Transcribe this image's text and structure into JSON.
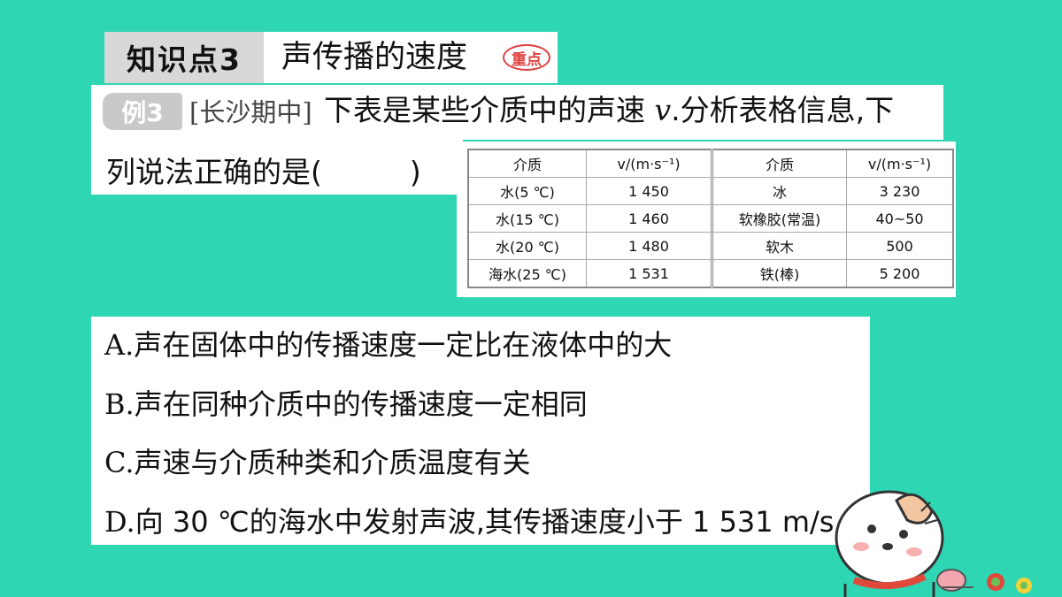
{
  "knowledge_point": {
    "tag": "知识点3",
    "title": "声传播的速度",
    "stamp": "重点"
  },
  "question": {
    "badge": "例3",
    "source": "[长沙期中]",
    "stem_line1_pre": "下表是某些介质中的声速 ",
    "stem_var": "v",
    "stem_line1_post": ".分析表格信息,下",
    "stem_line2": "列说法正确的是(　　　)"
  },
  "table": {
    "headers": [
      "介质",
      "v/(m·s⁻¹)",
      "介质",
      "v/(m·s⁻¹)"
    ],
    "rows": [
      [
        "水(5 ℃)",
        "1 450",
        "冰",
        "3 230"
      ],
      [
        "水(15 ℃)",
        "1 460",
        "软橡胶(常温)",
        "40~50"
      ],
      [
        "水(20 ℃)",
        "1 480",
        "软木",
        "500"
      ],
      [
        "海水(25 ℃)",
        "1 531",
        "铁(棒)",
        "5 200"
      ]
    ]
  },
  "options": [
    {
      "letter": "A.",
      "text": "声在固体中的传播速度一定比在液体中的大"
    },
    {
      "letter": "B.",
      "text": "声在同种介质中的传播速度一定相同"
    },
    {
      "letter": "C.",
      "text": "声速与介质种类和介质温度有关"
    },
    {
      "letter": "D.",
      "text": "向 30 ℃的海水中发射声波,其传播速度小于 1 531 m/s"
    }
  ]
}
